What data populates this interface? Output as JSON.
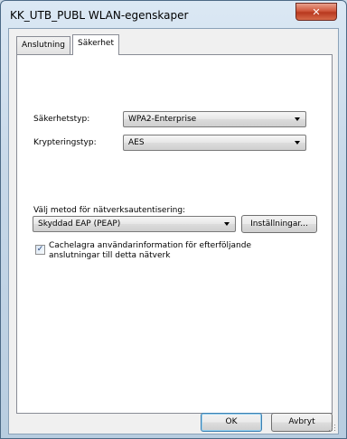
{
  "window": {
    "title": "KK_UTB_PUBL WLAN-egenskaper",
    "close_glyph": "✕"
  },
  "tabs": [
    {
      "label": "Anslutning",
      "active": false
    },
    {
      "label": "Säkerhet",
      "active": true
    }
  ],
  "security": {
    "security_type_label": "Säkerhetstyp:",
    "security_type_value": "WPA2-Enterprise",
    "encryption_type_label": "Krypteringstyp:",
    "encryption_type_value": "AES"
  },
  "auth": {
    "method_label": "Välj metod för nätverksautentisering:",
    "method_value": "Skyddad EAP (PEAP)",
    "settings_button": "Inställningar...",
    "cache_checkbox_line1": "Cachelagra användarinformation för efterföljande",
    "cache_checkbox_line2": "anslutningar till detta nätverk",
    "cache_checked": true,
    "check_glyph": "✓"
  },
  "footer": {
    "ok_button": "OK",
    "cancel_button": "Avbryt"
  },
  "colors": {
    "frame": "#c9d8e6",
    "close_button": "#c8472b",
    "default_button_border": "#3c7fb1"
  }
}
